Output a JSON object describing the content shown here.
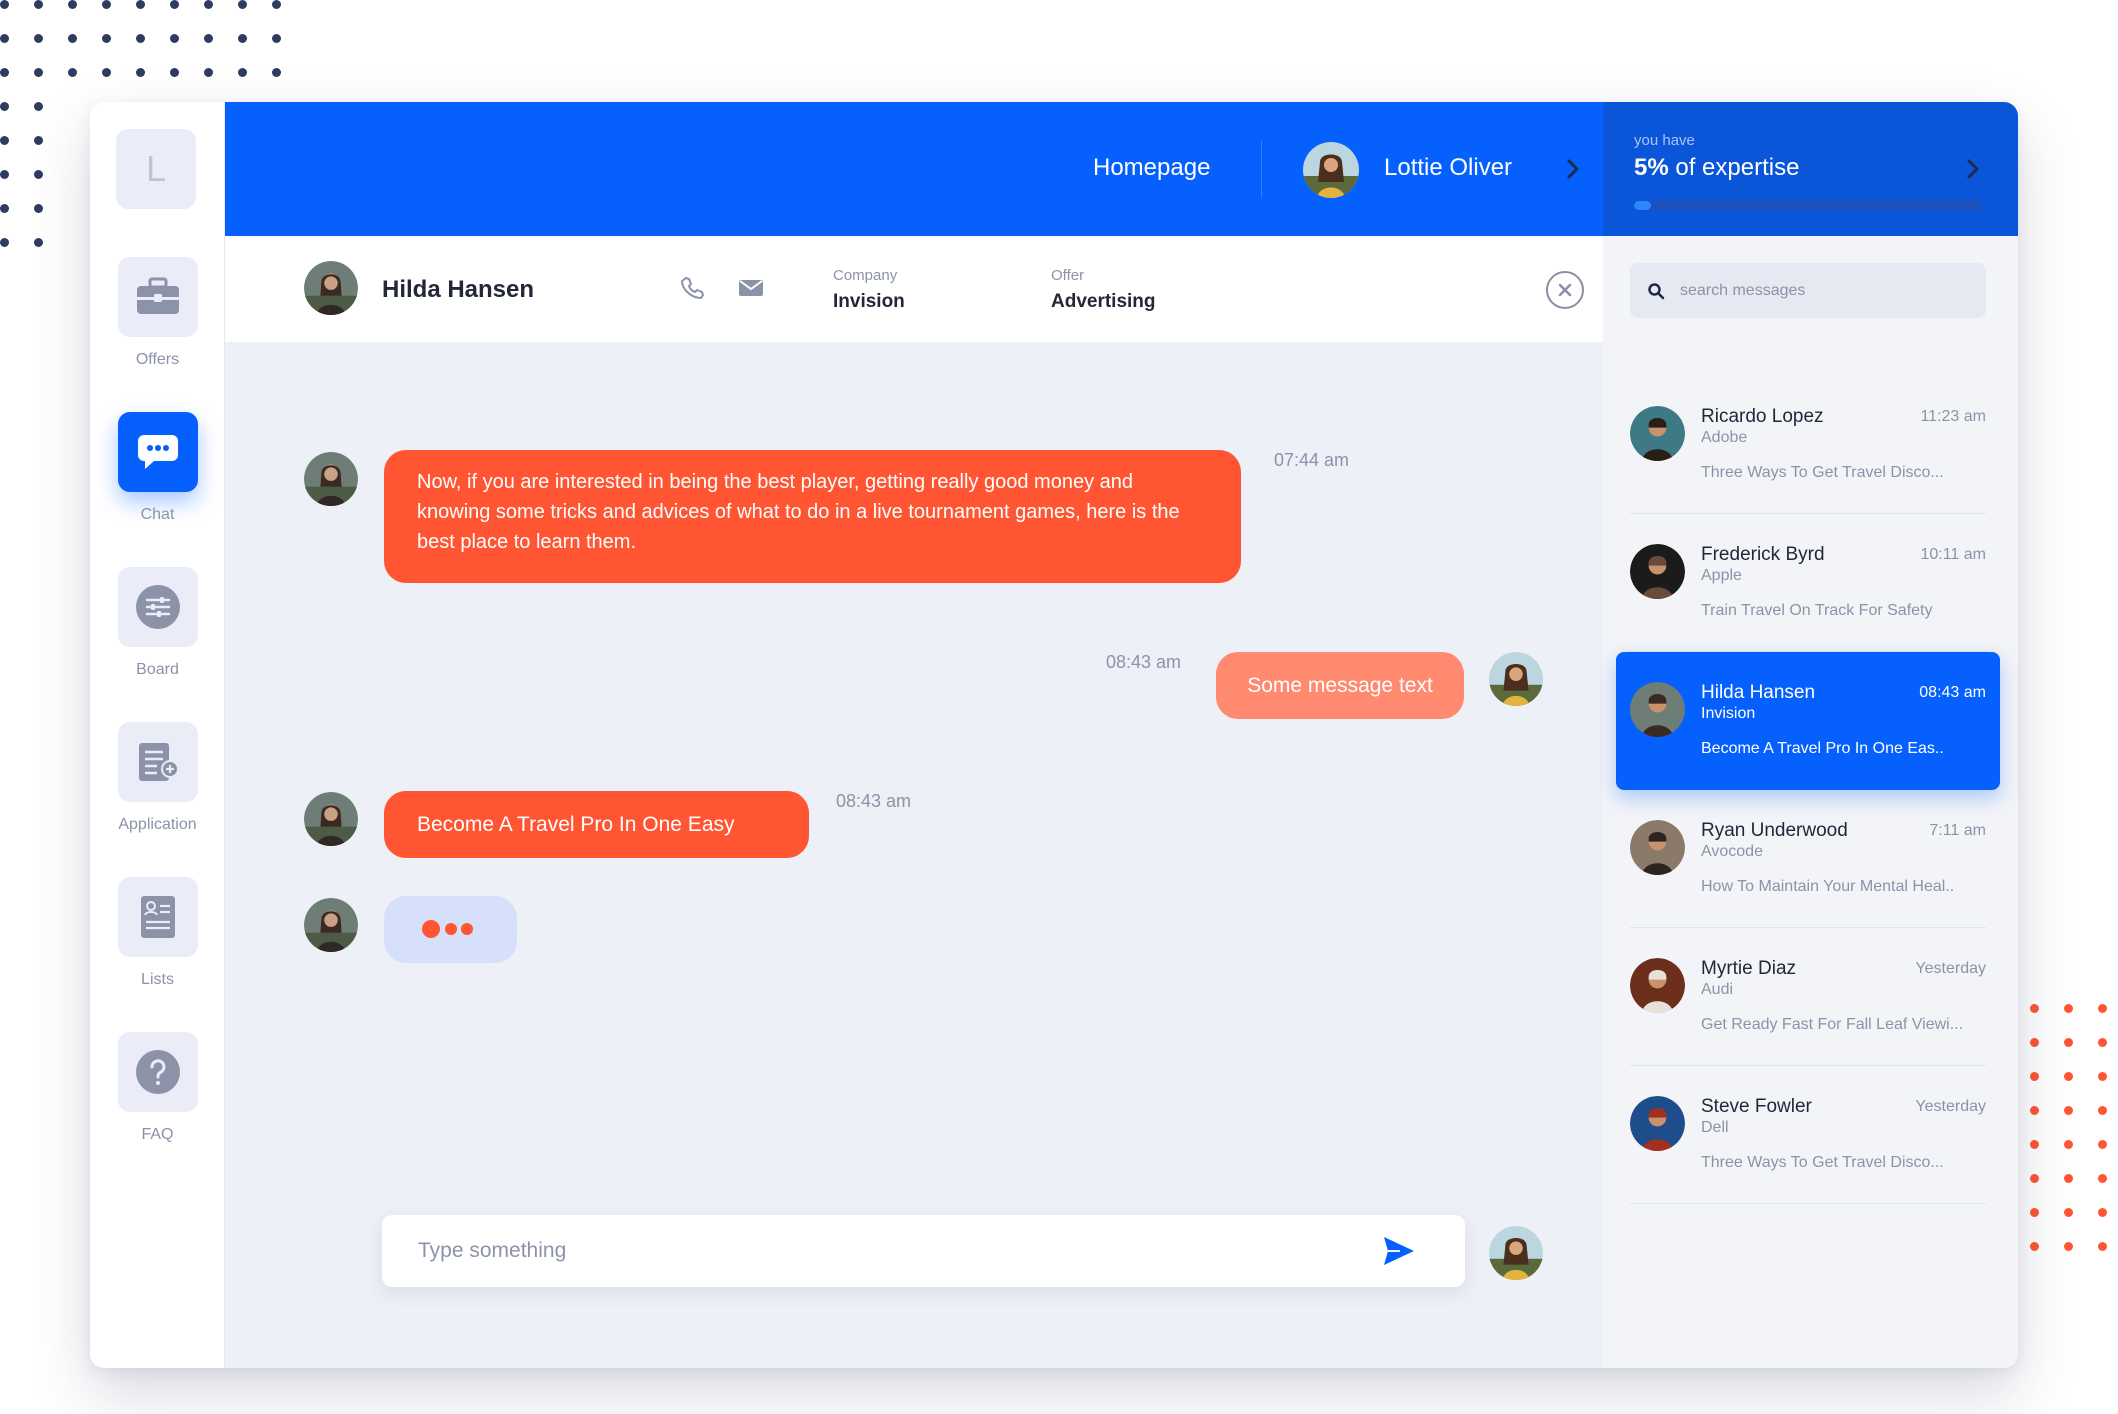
{
  "colors": {
    "primary": "#0660fe",
    "accent": "#ff5533",
    "accent_light": "#ff8a6f",
    "dot_dark": "#2f3b62",
    "dot_orange": "#ff5533"
  },
  "sidebar": {
    "logo_letter": "L",
    "items": [
      {
        "label": "Offers",
        "icon": "briefcase-icon",
        "active": false
      },
      {
        "label": "Chat",
        "icon": "chat-bubble-icon",
        "active": true
      },
      {
        "label": "Board",
        "icon": "sliders-icon",
        "active": false
      },
      {
        "label": "Application",
        "icon": "document-add-icon",
        "active": false
      },
      {
        "label": "Lists",
        "icon": "list-card-icon",
        "active": false
      },
      {
        "label": "FAQ",
        "icon": "question-icon",
        "active": false
      }
    ]
  },
  "header": {
    "homepage": "Homepage",
    "user_name": "Lottie Oliver",
    "expertise_caption": "you have",
    "expertise_value": "5%",
    "expertise_suffix": "of expertise",
    "expertise_progress": 0.05
  },
  "contact": {
    "name": "Hilda Hansen",
    "company_label": "Company",
    "company": "Invision",
    "offer_label": "Offer",
    "offer": "Advertising"
  },
  "messages": [
    {
      "text": "Now, if you are interested in being the best player, getting really good money and knowing some tricks and advices of what to do in a live tournament games, here is the best place to learn them.",
      "time": "07:44 am",
      "from": "contact"
    },
    {
      "text": "Some message text",
      "time": "08:43 am",
      "from": "me"
    },
    {
      "text": "Become A Travel Pro In One Easy",
      "time": "08:43 am",
      "from": "contact"
    }
  ],
  "composer": {
    "placeholder": "Type something"
  },
  "search": {
    "placeholder": "search messages"
  },
  "conversations": [
    {
      "name": "Ricardo Lopez",
      "company": "Adobe",
      "time": "11:23 am",
      "preview": "Three Ways To Get Travel Disco...",
      "active": false
    },
    {
      "name": "Frederick Byrd",
      "company": "Apple",
      "time": "10:11 am",
      "preview": "Train Travel On Track For Safety",
      "active": false
    },
    {
      "name": "Hilda Hansen",
      "company": "Invision",
      "time": "08:43 am",
      "preview": "Become A Travel Pro In One Eas..",
      "active": true
    },
    {
      "name": "Ryan Underwood",
      "company": "Avocode",
      "time": "7:11 am",
      "preview": "How To Maintain Your Mental Heal..",
      "active": false
    },
    {
      "name": "Myrtie Diaz",
      "company": "Audi",
      "time": "Yesterday",
      "preview": "Get Ready Fast For Fall Leaf Viewi...",
      "active": false
    },
    {
      "name": "Steve Fowler",
      "company": "Dell",
      "time": "Yesterday",
      "preview": "Three Ways To Get Travel Disco...",
      "active": false
    }
  ]
}
